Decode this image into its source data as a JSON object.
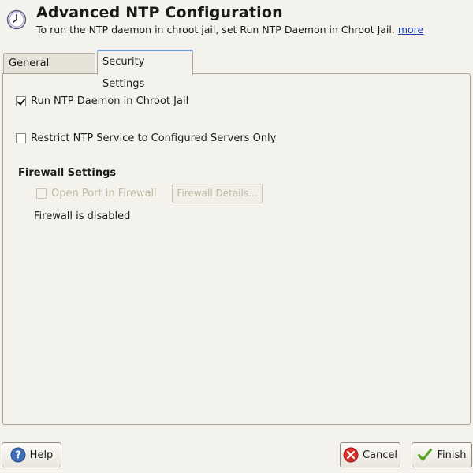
{
  "header": {
    "title": "Advanced NTP Configuration",
    "subtitle": "To run the NTP daemon in chroot jail, set Run NTP Daemon in Chroot Jail.",
    "more_link": "more",
    "icon": "clock-icon"
  },
  "tabs": [
    {
      "label": "General Settings",
      "active": false
    },
    {
      "label": "Security Settings",
      "active": true
    }
  ],
  "security": {
    "chroot": {
      "label": "Run NTP Daemon in Chroot Jail",
      "checked": true
    },
    "restrict": {
      "label": "Restrict NTP Service to Configured Servers Only",
      "checked": false
    },
    "firewall": {
      "section_title": "Firewall Settings",
      "open_port": {
        "label": "Open Port in Firewall",
        "checked": false,
        "enabled": false
      },
      "details_button": "Firewall Details...",
      "status": "Firewall is disabled"
    }
  },
  "buttons": {
    "help": "Help",
    "cancel": "Cancel",
    "finish": "Finish"
  },
  "icons": {
    "help": "help-icon",
    "cancel": "cancel-icon",
    "finish": "checkmark-icon"
  },
  "colors": {
    "window_bg": "#f4f2ec",
    "tab_accent": "#6f9bd4",
    "link": "#1a3fb0",
    "disabled_text": "#c1b89f",
    "cancel_icon": "#d9302b",
    "finish_icon": "#5aa82a"
  }
}
